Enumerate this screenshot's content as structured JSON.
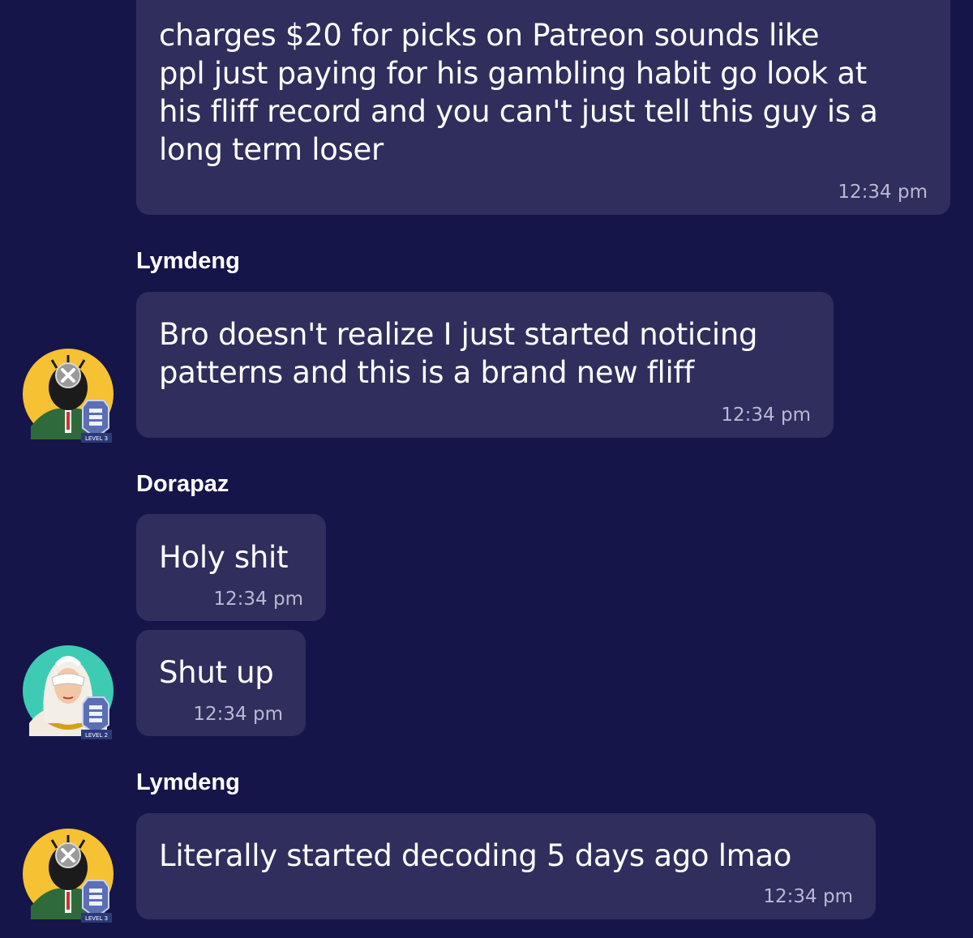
{
  "colors": {
    "background": "#15154a",
    "bubble": "#2f2e5c",
    "timestamp": "#b9b9d3",
    "avatar_yellow": "#f6c132",
    "avatar_teal": "#3ecbb4"
  },
  "messages": [
    {
      "text": "charges $20 for picks on Patreon sounds like\nppl just paying for his gambling habit go look at\nhis fliff record and you can't just tell this guy is a\nlong term loser",
      "time": "12:34 pm"
    },
    {
      "sender": "Lymdeng",
      "text": "Bro doesn't realize I just started noticing\npatterns and this is a brand new fliff",
      "time": "12:34 pm",
      "avatar": {
        "icon": "masked-agent-avatar",
        "badge": "LEVEL 3"
      }
    },
    {
      "sender": "Dorapaz",
      "text": "Holy shit",
      "time": "12:34 pm"
    },
    {
      "text": "Shut up",
      "time": "12:34 pm",
      "avatar": {
        "icon": "masked-woman-avatar",
        "badge": "LEVEL 2"
      }
    },
    {
      "sender": "Lymdeng",
      "text": "Literally started decoding 5 days ago lmao",
      "time": "12:34 pm",
      "avatar": {
        "icon": "masked-agent-avatar",
        "badge": "LEVEL 3"
      }
    }
  ]
}
